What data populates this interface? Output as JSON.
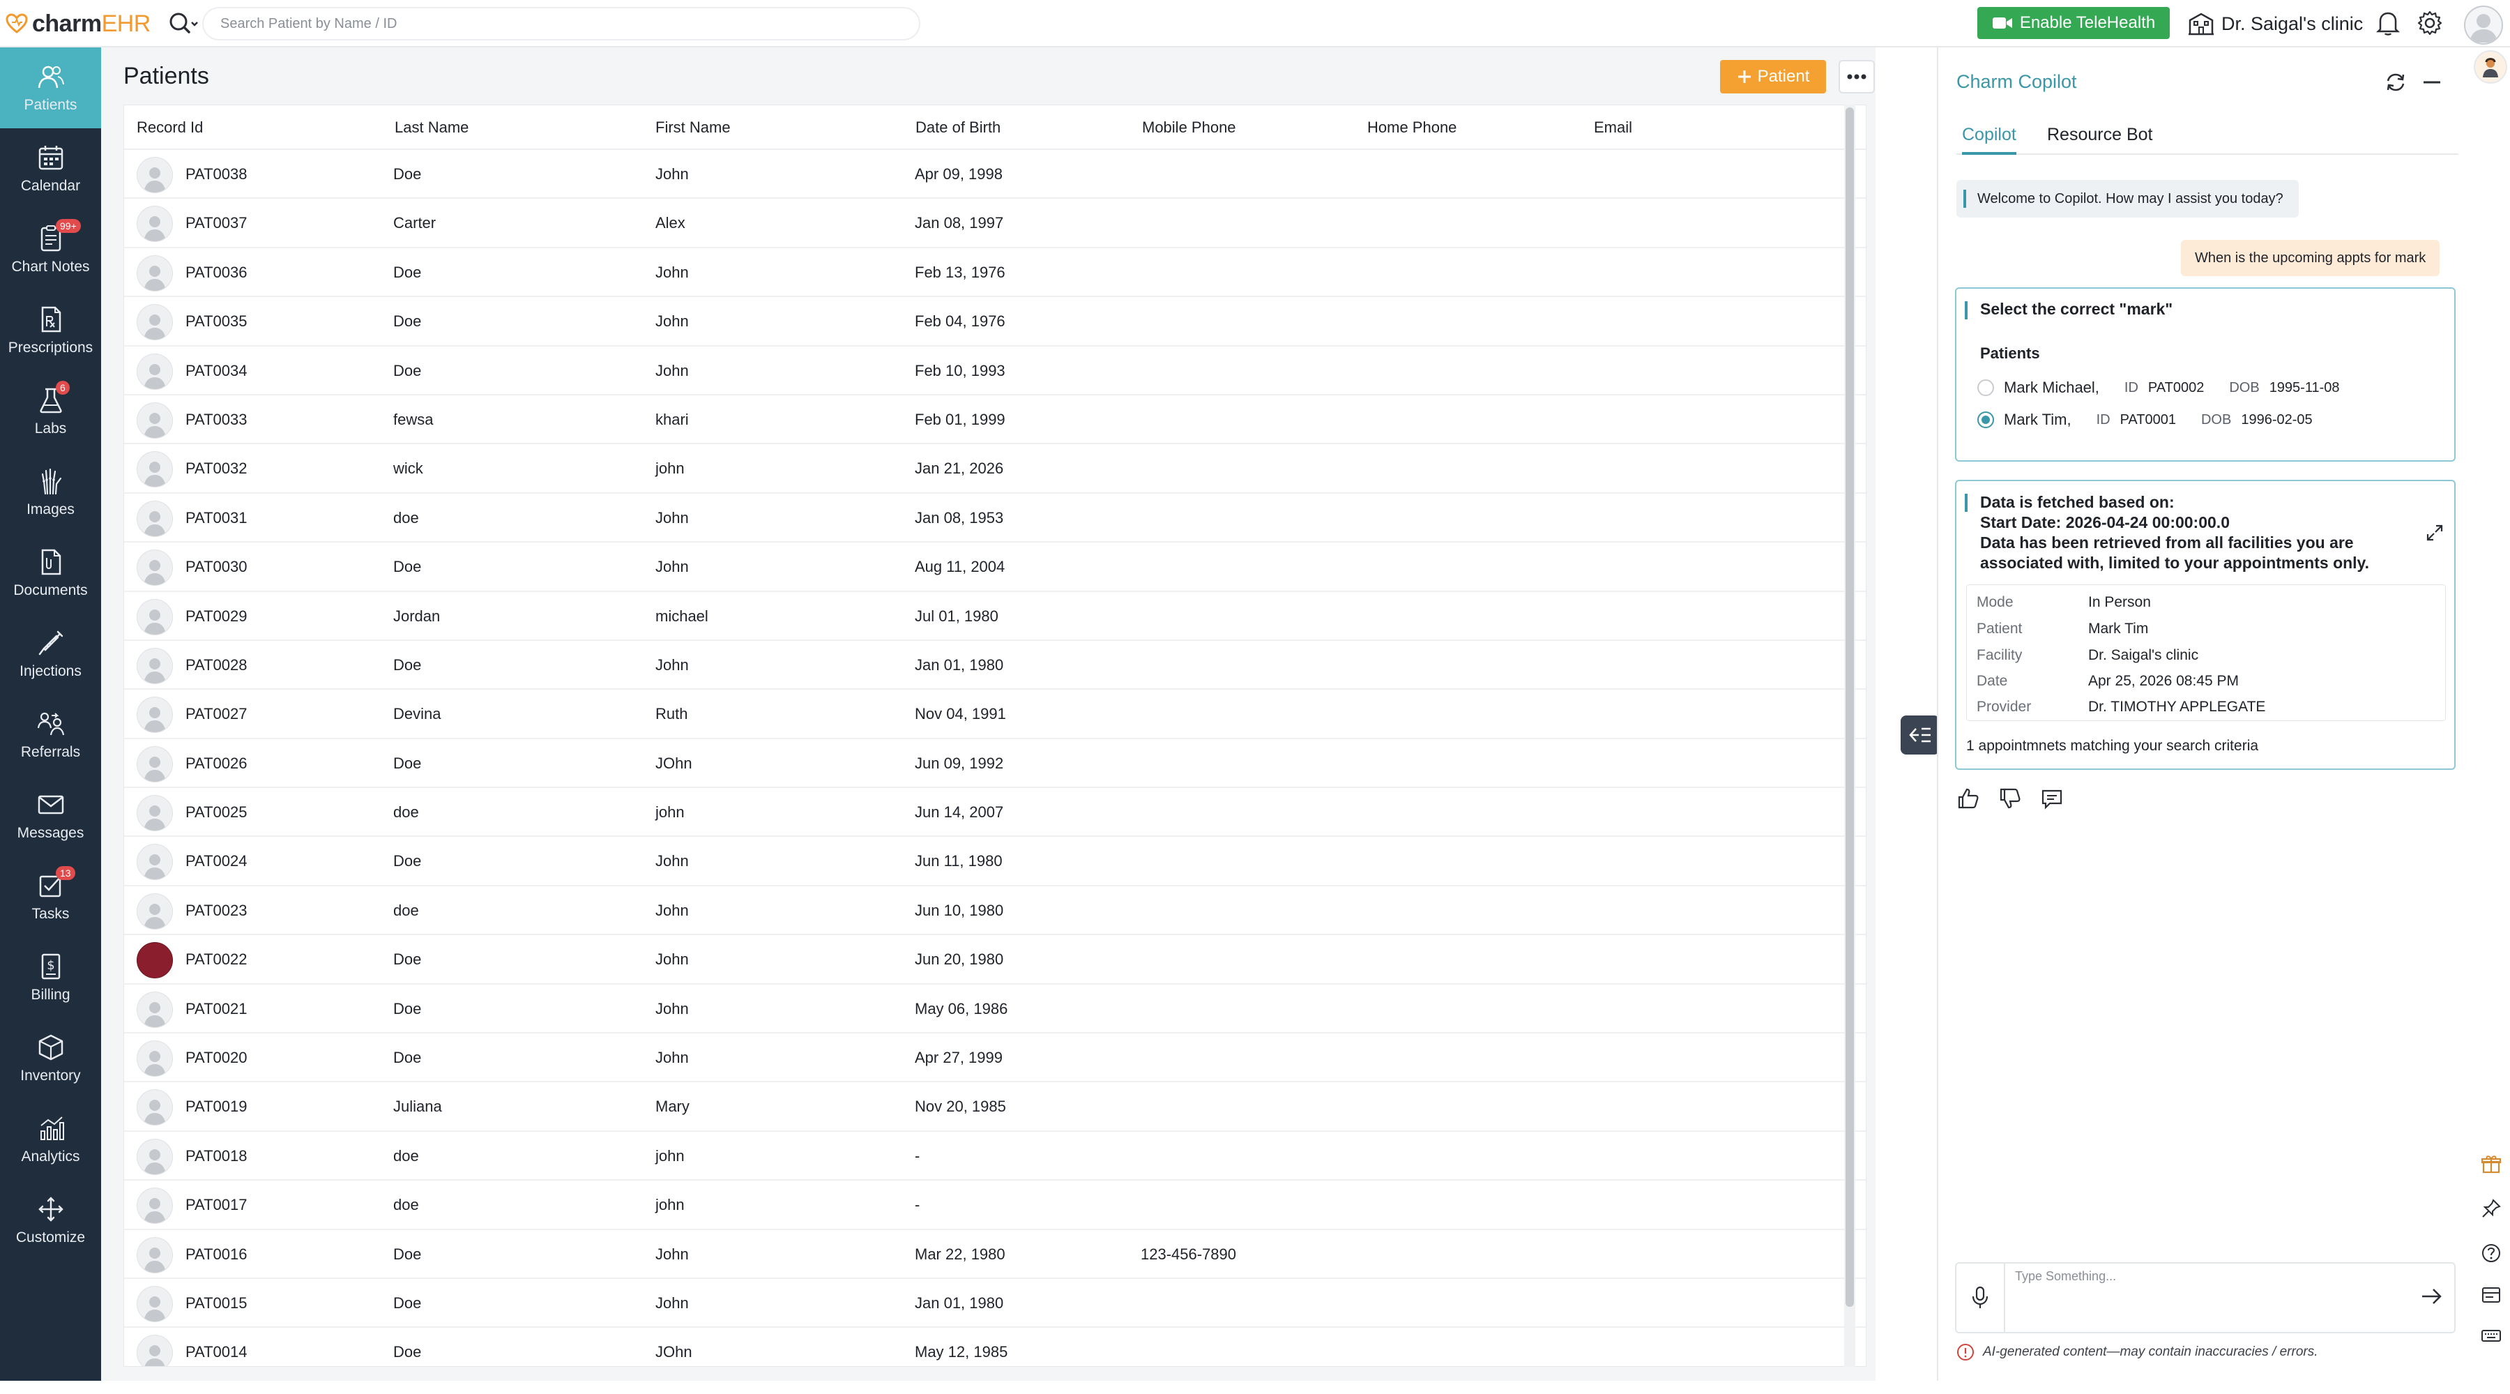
{
  "app": {
    "logo_main": "charm",
    "logo_accent": "EHR"
  },
  "search": {
    "placeholder": "Search Patient by Name / ID"
  },
  "header": {
    "telehealth_label": "Enable TeleHealth",
    "clinic_name": "Dr. Saigal's clinic"
  },
  "sidebar": {
    "items": [
      {
        "label": "Patients",
        "icon": "patients-icon",
        "badge": ""
      },
      {
        "label": "Calendar",
        "icon": "calendar-icon",
        "badge": ""
      },
      {
        "label": "Chart Notes",
        "icon": "chart-notes-icon",
        "badge": "99+"
      },
      {
        "label": "Prescriptions",
        "icon": "prescription-icon",
        "badge": ""
      },
      {
        "label": "Labs",
        "icon": "flask-icon",
        "badge": "6"
      },
      {
        "label": "Images",
        "icon": "xray-hand-icon",
        "badge": ""
      },
      {
        "label": "Documents",
        "icon": "document-icon",
        "badge": ""
      },
      {
        "label": "Injections",
        "icon": "syringe-icon",
        "badge": ""
      },
      {
        "label": "Referrals",
        "icon": "referrals-icon",
        "badge": ""
      },
      {
        "label": "Messages",
        "icon": "envelope-icon",
        "badge": ""
      },
      {
        "label": "Tasks",
        "icon": "tasks-icon",
        "badge": "13"
      },
      {
        "label": "Billing",
        "icon": "billing-icon",
        "badge": ""
      },
      {
        "label": "Inventory",
        "icon": "box-icon",
        "badge": ""
      },
      {
        "label": "Analytics",
        "icon": "analytics-icon",
        "badge": ""
      },
      {
        "label": "Customize",
        "icon": "move-icon",
        "badge": ""
      }
    ]
  },
  "patients": {
    "title": "Patients",
    "add_label": "Patient",
    "columns": [
      "Record Id",
      "Last Name",
      "First Name",
      "Date of Birth",
      "Mobile Phone",
      "Home Phone",
      "Email"
    ],
    "rows": [
      {
        "id": "PAT0038",
        "last": "Doe",
        "first": "John",
        "dob": "Apr 09, 1998",
        "mobile": "",
        "home": "",
        "email": ""
      },
      {
        "id": "PAT0037",
        "last": "Carter",
        "first": "Alex",
        "dob": "Jan 08, 1997",
        "mobile": "",
        "home": "",
        "email": ""
      },
      {
        "id": "PAT0036",
        "last": "Doe",
        "first": "John",
        "dob": "Feb 13, 1976",
        "mobile": "",
        "home": "",
        "email": ""
      },
      {
        "id": "PAT0035",
        "last": "Doe",
        "first": "John",
        "dob": "Feb 04, 1976",
        "mobile": "",
        "home": "",
        "email": ""
      },
      {
        "id": "PAT0034",
        "last": "Doe",
        "first": "John",
        "dob": "Feb 10, 1993",
        "mobile": "",
        "home": "",
        "email": ""
      },
      {
        "id": "PAT0033",
        "last": "fewsa",
        "first": "khari",
        "dob": "Feb 01, 1999",
        "mobile": "",
        "home": "",
        "email": ""
      },
      {
        "id": "PAT0032",
        "last": "wick",
        "first": "john",
        "dob": "Jan 21, 2026",
        "mobile": "",
        "home": "",
        "email": ""
      },
      {
        "id": "PAT0031",
        "last": "doe",
        "first": "John",
        "dob": "Jan 08, 1953",
        "mobile": "",
        "home": "",
        "email": ""
      },
      {
        "id": "PAT0030",
        "last": "Doe",
        "first": "John",
        "dob": "Aug 11, 2004",
        "mobile": "",
        "home": "",
        "email": ""
      },
      {
        "id": "PAT0029",
        "last": "Jordan",
        "first": "michael",
        "dob": "Jul 01, 1980",
        "mobile": "",
        "home": "",
        "email": ""
      },
      {
        "id": "PAT0028",
        "last": "Doe",
        "first": "John",
        "dob": "Jan 01, 1980",
        "mobile": "",
        "home": "",
        "email": ""
      },
      {
        "id": "PAT0027",
        "last": "Devina",
        "first": "Ruth",
        "dob": "Nov 04, 1991",
        "mobile": "",
        "home": "",
        "email": ""
      },
      {
        "id": "PAT0026",
        "last": "Doe",
        "first": "JOhn",
        "dob": "Jun 09, 1992",
        "mobile": "",
        "home": "",
        "email": ""
      },
      {
        "id": "PAT0025",
        "last": "doe",
        "first": "john",
        "dob": "Jun 14, 2007",
        "mobile": "",
        "home": "",
        "email": ""
      },
      {
        "id": "PAT0024",
        "last": "Doe",
        "first": "John",
        "dob": "Jun 11, 1980",
        "mobile": "",
        "home": "",
        "email": ""
      },
      {
        "id": "PAT0023",
        "last": "doe",
        "first": "John",
        "dob": "Jun 10, 1980",
        "mobile": "",
        "home": "",
        "email": ""
      },
      {
        "id": "PAT0022",
        "last": "Doe",
        "first": "John",
        "dob": "Jun 20, 1980",
        "mobile": "",
        "home": "",
        "email": ""
      },
      {
        "id": "PAT0021",
        "last": "Doe",
        "first": "John",
        "dob": "May 06, 1986",
        "mobile": "",
        "home": "",
        "email": ""
      },
      {
        "id": "PAT0020",
        "last": "Doe",
        "first": "John",
        "dob": "Apr 27, 1999",
        "mobile": "",
        "home": "",
        "email": ""
      },
      {
        "id": "PAT0019",
        "last": "Juliana",
        "first": "Mary",
        "dob": "Nov 20, 1985",
        "mobile": "",
        "home": "",
        "email": ""
      },
      {
        "id": "PAT0018",
        "last": "doe",
        "first": "john",
        "dob": "-",
        "mobile": "",
        "home": "",
        "email": ""
      },
      {
        "id": "PAT0017",
        "last": "doe",
        "first": "john",
        "dob": "-",
        "mobile": "",
        "home": "",
        "email": ""
      },
      {
        "id": "PAT0016",
        "last": "Doe",
        "first": "John",
        "dob": "Mar 22, 1980",
        "mobile": "123-456-7890",
        "home": "",
        "email": ""
      },
      {
        "id": "PAT0015",
        "last": "Doe",
        "first": "John",
        "dob": "Jan 01, 1980",
        "mobile": "",
        "home": "",
        "email": ""
      },
      {
        "id": "PAT0014",
        "last": "Doe",
        "first": "JOhn",
        "dob": "May 12, 1985",
        "mobile": "",
        "home": "",
        "email": ""
      }
    ]
  },
  "copilot": {
    "title": "Charm Copilot",
    "tabs": [
      "Copilot",
      "Resource Bot"
    ],
    "welcome": "Welcome to Copilot. How may I assist you today?",
    "user_message": "When is the upcoming appts for mark",
    "select_title": "Select the correct \"mark\"",
    "select_section": "Patients",
    "options": [
      {
        "name": "Mark Michael,",
        "id_label": "ID",
        "id": "PAT0002",
        "dob_label": "DOB",
        "dob": "1995-11-08",
        "checked": false
      },
      {
        "name": "Mark Tim,",
        "id_label": "ID",
        "id": "PAT0001",
        "dob_label": "DOB",
        "dob": "1996-02-05",
        "checked": true
      }
    ],
    "fetched_line1": "Data is fetched based on:",
    "fetched_line2": "Start Date: 2026-04-24 00:00:00.0",
    "fetched_line3": "Data has been retrieved from all facilities you are associated with, limited to your appointments only.",
    "details": [
      {
        "key": "Mode",
        "value": "In Person"
      },
      {
        "key": "Patient",
        "value": "Mark Tim"
      },
      {
        "key": "Facility",
        "value": "Dr. Saigal's clinic"
      },
      {
        "key": "Date",
        "value": "Apr 25, 2026 08:45 PM"
      },
      {
        "key": "Provider",
        "value": "Dr. TIMOTHY APPLEGATE"
      }
    ],
    "match_text": "1 appointmnets matching your search criteria",
    "input_placeholder": "Type Something...",
    "disclaimer": "AI-generated content—may contain inaccuracies / errors."
  },
  "colors": {
    "sidebar_bg": "#1f2d3d",
    "sidebar_active": "#4bb3c0",
    "accent_teal": "#3a97a8",
    "telehealth_green": "#35a854",
    "add_orange": "#f5a132"
  }
}
